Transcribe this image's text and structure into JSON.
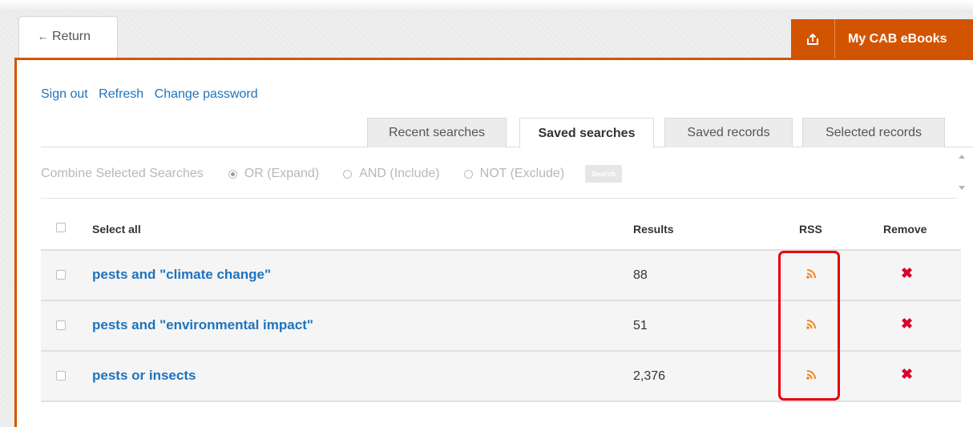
{
  "topbar": {
    "return_label": "Return",
    "brand_label": "My CAB eBooks",
    "brand_color": "#d35400"
  },
  "account_links": [
    "Sign out",
    "Refresh",
    "Change password"
  ],
  "tabs": [
    {
      "label": "Recent searches",
      "active": false
    },
    {
      "label": "Saved searches",
      "active": true
    },
    {
      "label": "Saved records",
      "active": false
    },
    {
      "label": "Selected records",
      "active": false
    }
  ],
  "combine": {
    "title": "Combine Selected Searches",
    "options": [
      {
        "label": "OR (Expand)",
        "checked": true
      },
      {
        "label": "AND (Include)",
        "checked": false
      },
      {
        "label": "NOT (Exclude)",
        "checked": false
      }
    ],
    "search_label": "Search"
  },
  "table": {
    "headers": {
      "select_all": "Select all",
      "results": "Results",
      "rss": "RSS",
      "remove": "Remove"
    },
    "rows": [
      {
        "query": "pests and \"climate change\"",
        "results": "88"
      },
      {
        "query": "pests and \"environmental impact\"",
        "results": "51"
      },
      {
        "query": "pests or insects",
        "results": "2,376"
      }
    ]
  },
  "icons": {
    "return": "left-arrow-icon",
    "share": "export-icon",
    "rss": "rss-icon",
    "remove": "close-icon"
  },
  "colors": {
    "link": "#1e73be",
    "rss": "#f0871f",
    "remove": "#d9002b",
    "highlight": "#e8000d"
  }
}
